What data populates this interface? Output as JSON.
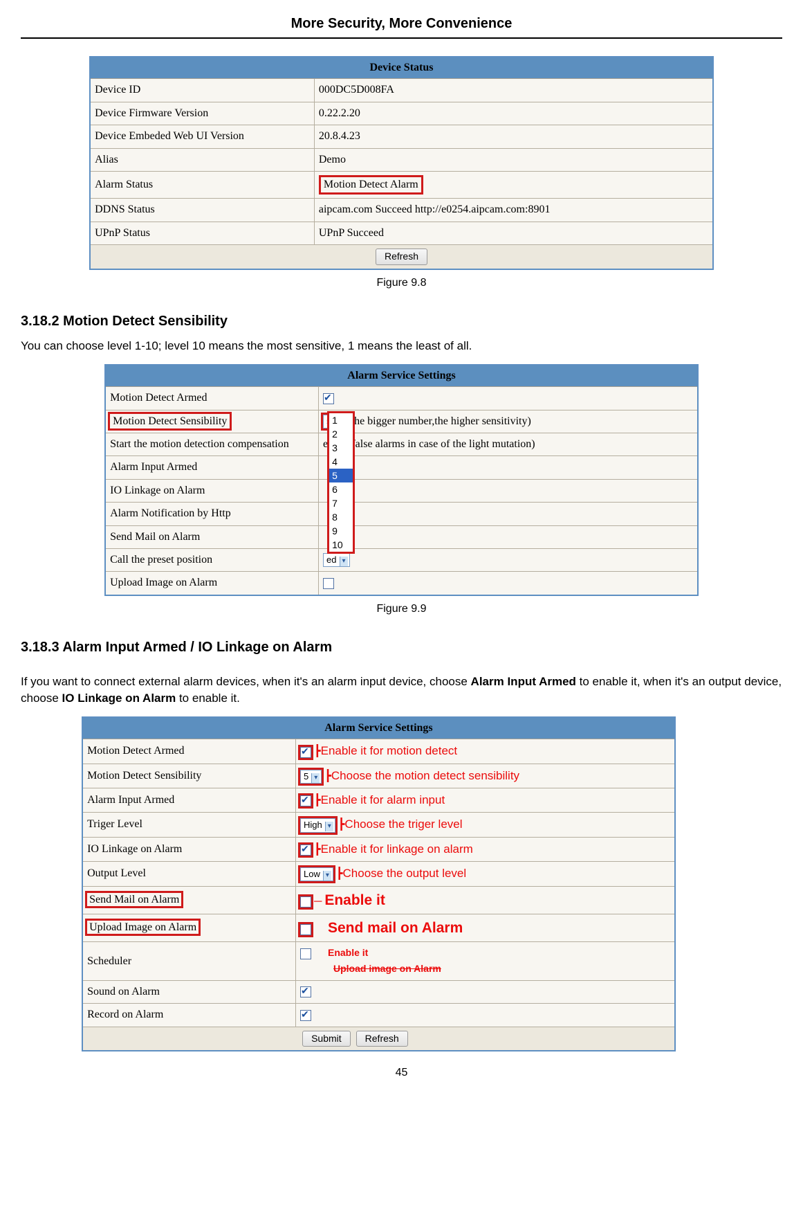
{
  "header": "More Security, More Convenience",
  "page_number": "45",
  "fig98": {
    "title": "Device Status",
    "rows": [
      {
        "label": "Device ID",
        "value": "000DC5D008FA"
      },
      {
        "label": "Device Firmware Version",
        "value": "0.22.2.20"
      },
      {
        "label": "Device Embeded Web UI Version",
        "value": "20.8.4.23"
      },
      {
        "label": "Alias",
        "value": "Demo"
      },
      {
        "label": "Alarm Status",
        "value": "Motion Detect Alarm"
      },
      {
        "label": "DDNS Status",
        "value": "aipcam.com  Succeed  http://e0254.aipcam.com:8901"
      },
      {
        "label": "UPnP Status",
        "value": "UPnP Succeed"
      }
    ],
    "refresh": "Refresh",
    "caption": "Figure 9.8"
  },
  "section2": {
    "heading": "3.18.2 Motion Detect Sensibility",
    "body": "You can choose level 1-10; level 10 means the most sensitive, 1 means the least of all."
  },
  "fig99": {
    "title": "Alarm Service Settings",
    "rows": [
      {
        "label": "Motion Detect Armed"
      },
      {
        "label": "Motion Detect Sensibility",
        "sel": "5",
        "note": "(the bigger number,the higher sensitivity)"
      },
      {
        "label": "Start the motion detection compensation",
        "note": "educe false alarms in case of the light mutation)"
      },
      {
        "label": "Alarm Input Armed"
      },
      {
        "label": "IO Linkage on Alarm"
      },
      {
        "label": "Alarm Notification by Http"
      },
      {
        "label": "Send Mail on Alarm"
      },
      {
        "label": "Call the preset position",
        "sel": "ed"
      },
      {
        "label": "Upload Image on Alarm"
      }
    ],
    "options": [
      "1",
      "2",
      "3",
      "4",
      "5",
      "6",
      "7",
      "8",
      "9",
      "10"
    ],
    "caption": "Figure 9.9"
  },
  "section3": {
    "heading": "3.18.3 Alarm Input Armed / IO Linkage on Alarm",
    "body_pre": "If you want to connect external alarm devices, when it's an alarm input device, choose ",
    "bold1": "Alarm Input Armed",
    "body_mid": " to enable it, when it's an output device, choose ",
    "bold2": "IO Linkage on Alarm",
    "body_post": " to enable it."
  },
  "fig3": {
    "title": "Alarm Service Settings",
    "rows": [
      {
        "label": "Motion Detect Armed",
        "ctrl": "chk-on",
        "annot": "Enable it for motion detect"
      },
      {
        "label": "Motion Detect Sensibility",
        "ctrl": "sel",
        "sel": "5",
        "annot": "Choose the motion detect sensibility"
      },
      {
        "label": "Alarm Input Armed",
        "ctrl": "chk-on",
        "annot": "Enable it for alarm input"
      },
      {
        "label": "Triger Level",
        "ctrl": "sel",
        "sel": "High",
        "annot": "Choose the triger level"
      },
      {
        "label": "IO Linkage on Alarm",
        "ctrl": "chk-on",
        "annot": "Enable it for linkage on alarm"
      },
      {
        "label": "Output Level",
        "ctrl": "sel",
        "sel": "Low",
        "annot": "Choose the output level"
      },
      {
        "label": "Send Mail on Alarm",
        "ctrl": "chk-off",
        "hl": true
      },
      {
        "label": "Upload Image on Alarm",
        "ctrl": "chk-off",
        "hl": true
      },
      {
        "label": "Scheduler",
        "ctrl": "chk-off"
      },
      {
        "label": "Sound on Alarm",
        "ctrl": "chk-on"
      },
      {
        "label": "Record on Alarm",
        "ctrl": "chk-on"
      }
    ],
    "annot_enable": "Enable it",
    "annot_sendmail": "Send mail on Alarm",
    "annot_enable2": "Enable it",
    "annot_upload": "Upload image on Alarm",
    "submit": "Submit",
    "refresh": "Refresh"
  }
}
